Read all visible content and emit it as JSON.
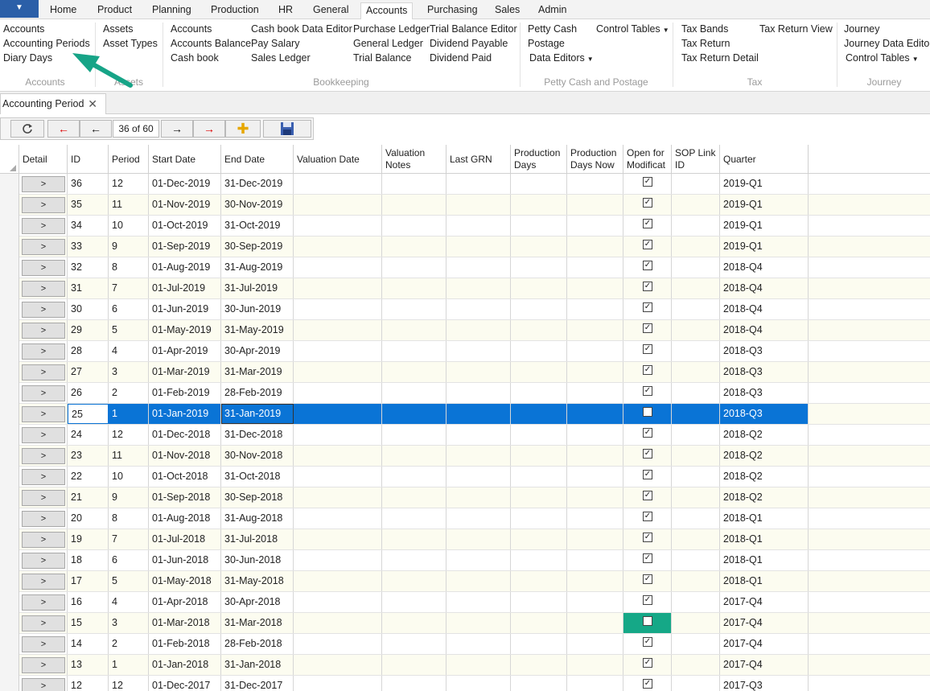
{
  "tabs": [
    "Home",
    "Product",
    "Planning",
    "Production",
    "HR",
    "General",
    "Accounts",
    "Purchasing",
    "Sales",
    "Admin"
  ],
  "active_tab": "Accounts",
  "ribbon": {
    "accounts_group": {
      "items": [
        "Accounts",
        "Accounting Periods",
        "Diary Days"
      ],
      "label": "Accounts"
    },
    "assets_group": {
      "items": [
        "Assets",
        "Asset Types"
      ],
      "label": "Assets"
    },
    "bookkeeping_group": {
      "items": [
        "Accounts",
        "Accounts Balance",
        "Cash book",
        "Cash book Data Editor",
        "Pay Salary",
        "Sales Ledger",
        "Purchase Ledger",
        "General Ledger",
        "Trial Balance",
        "Trial Balance Editor",
        "Dividend Payable",
        "Dividend Paid"
      ],
      "label": "Bookkeeping"
    },
    "petty_group": {
      "items": [
        "Petty Cash",
        "Postage",
        "Data Editors",
        "Control Tables"
      ],
      "label": "Petty Cash and Postage"
    },
    "tax_group": {
      "items": [
        "Tax Bands",
        "Tax Return",
        "Tax Return Detail",
        "Tax Return View"
      ],
      "label": "Tax"
    },
    "journey_group": {
      "items": [
        "Journey",
        "Journey Data Editor",
        "Control Tables"
      ],
      "label": "Journey"
    }
  },
  "doc_tab": {
    "title": "Accounting Period"
  },
  "navigator": {
    "position": "36 of 60"
  },
  "grid": {
    "columns": [
      "Detail",
      "ID",
      "Period",
      "Start Date",
      "End Date",
      "Valuation Date",
      "Valuation Notes",
      "Last GRN",
      "Production Days",
      "Production Days Now",
      "Open for Modificat",
      "SOP Link ID",
      "Quarter"
    ],
    "detail_label": ">",
    "check_mark": "✓",
    "rows": [
      {
        "id": "36",
        "period": "12",
        "start": "01-Dec-2019",
        "end": "31-Dec-2019",
        "open": true,
        "quarter": "2019-Q1"
      },
      {
        "id": "35",
        "period": "11",
        "start": "01-Nov-2019",
        "end": "30-Nov-2019",
        "open": true,
        "quarter": "2019-Q1"
      },
      {
        "id": "34",
        "period": "10",
        "start": "01-Oct-2019",
        "end": "31-Oct-2019",
        "open": true,
        "quarter": "2019-Q1"
      },
      {
        "id": "33",
        "period": "9",
        "start": "01-Sep-2019",
        "end": "30-Sep-2019",
        "open": true,
        "quarter": "2019-Q1"
      },
      {
        "id": "32",
        "period": "8",
        "start": "01-Aug-2019",
        "end": "31-Aug-2019",
        "open": true,
        "quarter": "2018-Q4"
      },
      {
        "id": "31",
        "period": "7",
        "start": "01-Jul-2019",
        "end": "31-Jul-2019",
        "open": true,
        "quarter": "2018-Q4"
      },
      {
        "id": "30",
        "period": "6",
        "start": "01-Jun-2019",
        "end": "30-Jun-2019",
        "open": true,
        "quarter": "2018-Q4"
      },
      {
        "id": "29",
        "period": "5",
        "start": "01-May-2019",
        "end": "31-May-2019",
        "open": true,
        "quarter": "2018-Q4"
      },
      {
        "id": "28",
        "period": "4",
        "start": "01-Apr-2019",
        "end": "30-Apr-2019",
        "open": true,
        "quarter": "2018-Q3"
      },
      {
        "id": "27",
        "period": "3",
        "start": "01-Mar-2019",
        "end": "31-Mar-2019",
        "open": true,
        "quarter": "2018-Q3"
      },
      {
        "id": "26",
        "period": "2",
        "start": "01-Feb-2019",
        "end": "28-Feb-2019",
        "open": true,
        "quarter": "2018-Q3"
      },
      {
        "id": "25",
        "period": "1",
        "start": "01-Jan-2019",
        "end": "31-Jan-2019",
        "open": true,
        "quarter": "2018-Q3",
        "selected": true
      },
      {
        "id": "24",
        "period": "12",
        "start": "01-Dec-2018",
        "end": "31-Dec-2018",
        "open": true,
        "quarter": "2018-Q2"
      },
      {
        "id": "23",
        "period": "11",
        "start": "01-Nov-2018",
        "end": "30-Nov-2018",
        "open": true,
        "quarter": "2018-Q2"
      },
      {
        "id": "22",
        "period": "10",
        "start": "01-Oct-2018",
        "end": "31-Oct-2018",
        "open": true,
        "quarter": "2018-Q2"
      },
      {
        "id": "21",
        "period": "9",
        "start": "01-Sep-2018",
        "end": "30-Sep-2018",
        "open": true,
        "quarter": "2018-Q2"
      },
      {
        "id": "20",
        "period": "8",
        "start": "01-Aug-2018",
        "end": "31-Aug-2018",
        "open": true,
        "quarter": "2018-Q1"
      },
      {
        "id": "19",
        "period": "7",
        "start": "01-Jul-2018",
        "end": "31-Jul-2018",
        "open": true,
        "quarter": "2018-Q1"
      },
      {
        "id": "18",
        "period": "6",
        "start": "01-Jun-2018",
        "end": "30-Jun-2018",
        "open": true,
        "quarter": "2018-Q1"
      },
      {
        "id": "17",
        "period": "5",
        "start": "01-May-2018",
        "end": "31-May-2018",
        "open": true,
        "quarter": "2018-Q1"
      },
      {
        "id": "16",
        "period": "4",
        "start": "01-Apr-2018",
        "end": "30-Apr-2018",
        "open": true,
        "quarter": "2017-Q4"
      },
      {
        "id": "15",
        "period": "3",
        "start": "01-Mar-2018",
        "end": "31-Mar-2018",
        "open": false,
        "quarter": "2017-Q4",
        "highlight_open": true
      },
      {
        "id": "14",
        "period": "2",
        "start": "01-Feb-2018",
        "end": "28-Feb-2018",
        "open": true,
        "quarter": "2017-Q4"
      },
      {
        "id": "13",
        "period": "1",
        "start": "01-Jan-2018",
        "end": "31-Jan-2018",
        "open": true,
        "quarter": "2017-Q4"
      },
      {
        "id": "12",
        "period": "12",
        "start": "01-Dec-2017",
        "end": "31-Dec-2017",
        "open": true,
        "quarter": "2017-Q3"
      }
    ]
  },
  "colors": {
    "selection": "#0a74d6",
    "highlight": "#15a887",
    "arrow": "#17a487",
    "alt_row": "#fcfcf0"
  }
}
